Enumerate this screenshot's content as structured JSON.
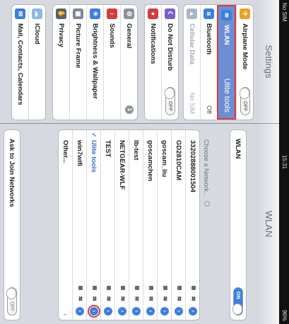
{
  "status": {
    "carrier": "No SIM",
    "time": "15:31",
    "battery": "96%"
  },
  "left": {
    "title": "Settings",
    "group1": [
      {
        "label": "Airplane Mode",
        "icon": "airplane-icon",
        "color": "#f0a020",
        "toggle": "OFF"
      },
      {
        "label": "WLAN",
        "icon": "wifi-icon",
        "color": "#3b7fe0",
        "value": "Ulite tools",
        "selected": true
      },
      {
        "label": "Bluetooth",
        "icon": "bluetooth-icon",
        "color": "#3b7fe0",
        "value": "Off"
      },
      {
        "label": "Cellular Data",
        "icon": "antenna-icon",
        "color": "#a8b5c8",
        "value": "No SIM",
        "dimmed": true
      }
    ],
    "group2": [
      {
        "label": "Do Not Disturb",
        "icon": "moon-icon",
        "color": "#7d5ccf",
        "toggle": "OFF"
      },
      {
        "label": "Notifications",
        "icon": "notifications-icon",
        "color": "#d43b3b"
      }
    ],
    "group3": [
      {
        "label": "General",
        "icon": "gear-icon",
        "color": "#8e9299",
        "badge": "1"
      },
      {
        "label": "Sounds",
        "icon": "speaker-icon",
        "color": "#d43b3b"
      },
      {
        "label": "Brightness & Wallpaper",
        "icon": "brightness-icon",
        "color": "#3b7fe0"
      },
      {
        "label": "Picture Frame",
        "icon": "picture-frame-icon",
        "color": "#7f8590"
      },
      {
        "label": "Privacy",
        "icon": "hand-icon",
        "color": "#5a6170"
      }
    ],
    "group4": [
      {
        "label": "iCloud",
        "icon": "cloud-icon",
        "color": "#8fb7e8"
      },
      {
        "label": "Mail, Contacts, Calendars",
        "icon": "mail-icon",
        "color": "#3b7fe0"
      }
    ]
  },
  "right": {
    "title": "WLAN",
    "wlan_label": "WLAN",
    "wlan_toggle": "ON",
    "choose_label": "Choose a Network...",
    "networks": [
      {
        "name": "33202888001504"
      },
      {
        "name": "GD2810CAM"
      },
      {
        "name": "goscam_liu"
      },
      {
        "name": "goscamchen"
      },
      {
        "name": "lb-test"
      },
      {
        "name": "NETGEAR-WLF"
      },
      {
        "name": "TEST"
      },
      {
        "name": "Ulite tools",
        "connected": true
      },
      {
        "name": "win7wifi"
      },
      {
        "name": "Other..."
      }
    ],
    "ask_label": "Ask to Join Networks",
    "ask_toggle": "OFF"
  }
}
